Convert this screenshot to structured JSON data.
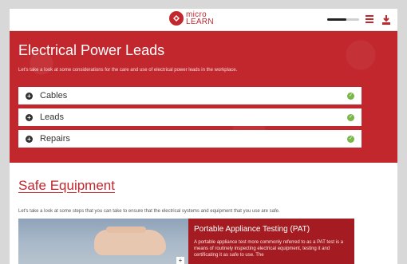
{
  "header": {
    "logo_line1": "micro",
    "logo_line2": "LEARN",
    "progress_fraction": 0.6
  },
  "hero": {
    "title": "Electrical Power Leads",
    "subtitle": "Let's take a look at some considerations for the care and use of electrical power leads in the workplace.",
    "accordion": [
      {
        "label": "Cables",
        "complete": true
      },
      {
        "label": "Leads",
        "complete": true
      },
      {
        "label": "Repairs",
        "complete": true
      }
    ]
  },
  "section": {
    "title": "Safe Equipment",
    "subtitle": "Let's take a look at some steps that you can take to ensure that the electrical systems and equipment that you use are safe."
  },
  "card": {
    "title": "Portable Appliance Testing (PAT)",
    "body": "A portable appliance test more commonly referred to as a PAT test is a means of routinely inspecting electrical equipment, testing it and certificating it as safe to use. The"
  },
  "colors": {
    "brand": "#c1272d",
    "card_bg": "#a41c22",
    "check": "#7ab648"
  },
  "icons": {
    "logo": "microlearn-logo-icon",
    "menu": "hamburger-menu-icon",
    "download": "download-icon",
    "expand": "plus-circle-icon",
    "complete": "check-circle-icon",
    "hotspot": "plus-icon"
  }
}
